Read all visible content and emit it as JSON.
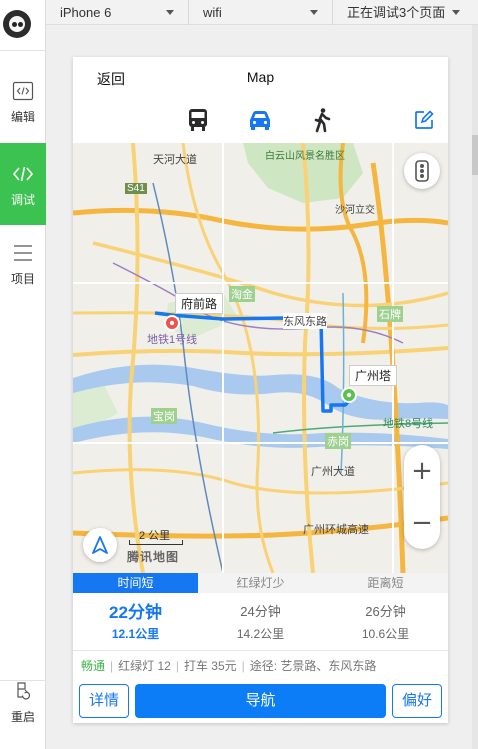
{
  "toolbar": {
    "device": "iPhone 6",
    "network": "wifi",
    "debug_pages": "正在调试3个页面"
  },
  "sidebar": {
    "items": [
      {
        "label": "编辑",
        "icon": "code-box-icon"
      },
      {
        "label": "调试",
        "icon": "code-icon",
        "active": true
      },
      {
        "label": "项目",
        "icon": "list-icon"
      },
      {
        "label": "重启",
        "icon": "restart-icon"
      }
    ]
  },
  "nav": {
    "back": "返回",
    "title": "Map"
  },
  "modes": [
    {
      "name": "bus-icon",
      "active": false
    },
    {
      "name": "car-icon",
      "active": true
    },
    {
      "name": "walk-icon",
      "active": false
    },
    {
      "name": "edit-icon",
      "active": false
    }
  ],
  "map": {
    "origin_label": "府前路",
    "destination_label": "广州塔",
    "scale": "2 公里",
    "logo": "腾讯地图",
    "place_labels": [
      "白云山风景名胜区",
      "天河大道",
      "东风东路",
      "淘金",
      "石牌",
      "宝岗",
      "赤岗",
      "广州大道",
      "地铁1号线",
      "地铁8号线",
      "广州环城高速",
      "沙河立交",
      "S41"
    ]
  },
  "route_tabs": [
    "时间短",
    "红绿灯少",
    "距离短"
  ],
  "routes": [
    {
      "time": "22分钟",
      "distance": "12.1公里"
    },
    {
      "time": "24分钟",
      "distance": "14.2公里"
    },
    {
      "time": "26分钟",
      "distance": "10.6公里"
    }
  ],
  "info": {
    "traffic": "畅通",
    "lights": "红绿灯 12",
    "taxi": "打车 35元",
    "via": "途径: 艺景路、东风东路"
  },
  "buttons": {
    "detail": "详情",
    "navigate": "导航",
    "prefer": "偏好"
  },
  "colors": {
    "accent": "#1677f2",
    "sidebar_active": "#3cc251",
    "traffic_good": "#3cb549"
  }
}
